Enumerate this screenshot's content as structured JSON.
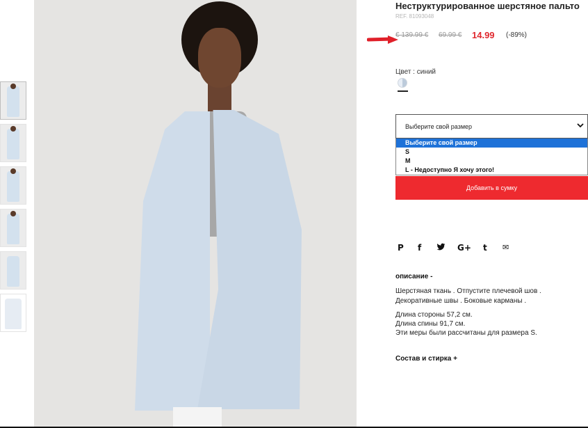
{
  "product": {
    "title": "Неструктурированное шерстяное пальто",
    "ref": "REF. 81093048",
    "old_price_1": "€ 139.99 €",
    "old_price_2": "69.99 €",
    "price": "14.99",
    "discount": "(-89%)",
    "accent_color": "#e0282e"
  },
  "color": {
    "label": "Цвет : синий",
    "swatch_name": "light-blue"
  },
  "size_select": {
    "value": "Выберите свой размер",
    "options": [
      {
        "label": "Выберите свой размер",
        "highlighted": true
      },
      {
        "label": "S"
      },
      {
        "label": "M"
      },
      {
        "label": "L",
        "note": " - Недоступно Я хочу этого!"
      }
    ]
  },
  "add_to_bag": "Добавить в сумку",
  "social_icons": [
    "pinterest-icon",
    "facebook-icon",
    "twitter-icon",
    "google-plus-icon",
    "tumblr-icon",
    "email-icon"
  ],
  "social_glyphs": {
    "pinterest": "P",
    "facebook": "f",
    "twitter": "🐦",
    "google": "G+",
    "tumblr": "t",
    "email": "✉"
  },
  "description": {
    "title": "описание -",
    "text": "Шерстяная ткань . Отпустите плечевой шов . Декоративные швы . Боковые карманы .",
    "measure_1": "Длина стороны 57,2 см.",
    "measure_2": "Длина спины 91,7 см.",
    "measure_3": "Эти меры были рассчитаны для размера S."
  },
  "composition": "Состав и стирка +"
}
